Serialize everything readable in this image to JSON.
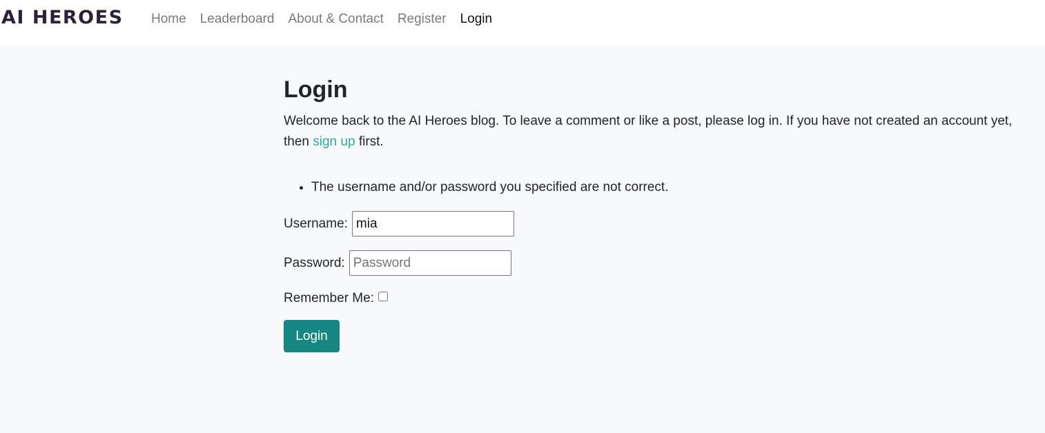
{
  "navbar": {
    "brand": "AI HEROES",
    "links": [
      {
        "label": "Home"
      },
      {
        "label": "Leaderboard"
      },
      {
        "label": "About & Contact"
      },
      {
        "label": "Register"
      },
      {
        "label": "Login"
      }
    ],
    "active_link": "Login"
  },
  "page": {
    "title": "Login",
    "intro_before_link": "Welcome back to the AI Heroes blog. To leave a comment or like a post, please log in. If you have not created an account yet, then ",
    "signup_link": "sign up",
    "intro_after_link": " first.",
    "error_message": "The username and/or password you specified are not correct."
  },
  "form": {
    "username_label": "Username:",
    "username_value": "mia",
    "password_label": "Password:",
    "password_placeholder": "Password",
    "password_value": "",
    "remember_label": "Remember Me:",
    "remember_checked": false,
    "submit_label": "Login"
  },
  "colors": {
    "accent": "#168680",
    "link": "#2fa7a0",
    "page_background": "#f8f9fa",
    "navbar_background": "#ffffff"
  }
}
